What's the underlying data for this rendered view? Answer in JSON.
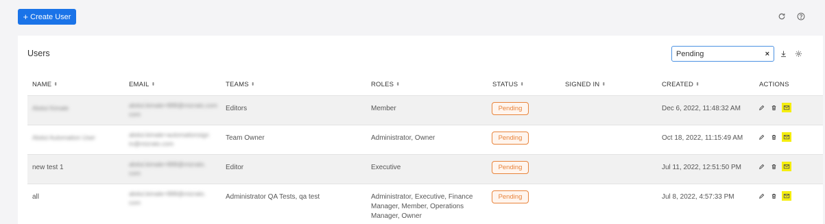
{
  "toolbar": {
    "create_label": "Create User",
    "plus": "+"
  },
  "table": {
    "title": "Users",
    "search": {
      "value": "Pending",
      "clear": "×"
    },
    "columns": [
      "NAME",
      "EMAIL",
      "TEAMS",
      "ROLES",
      "STATUS",
      "SIGNED IN",
      "CREATED",
      "ACTIONS"
    ],
    "sort_glyph": "⬍",
    "rows": [
      {
        "name": "Abdul Kimale",
        "email_1": "abdul.kimale+888@mizrato.com",
        "email_2": "com",
        "teams": "Editors",
        "roles": [
          "Member"
        ],
        "status": "Pending",
        "signed_in": "",
        "created": "Dec 6, 2022, 11:48:32 AM"
      },
      {
        "name": "Abdul Automation User",
        "email_1": "abdul.kimale+automationsign",
        "email_2": "in@mizrato.com",
        "teams": "Team Owner",
        "roles": [
          "Administrator, Owner"
        ],
        "status": "Pending",
        "signed_in": "",
        "created": "Oct 18, 2022, 11:15:49 AM"
      },
      {
        "name": "new test 1",
        "email_1": "abdul.kimale+888@mizrato.",
        "email_2": "com",
        "teams": "Editor",
        "roles": [
          "Executive"
        ],
        "status": "Pending",
        "signed_in": "",
        "created": "Jul 11, 2022, 12:51:50 PM"
      },
      {
        "name": "all",
        "email_1": "abdul.kimale+888@mizrato.",
        "email_2": "com",
        "teams": "Administrator QA Tests, qa test",
        "roles": [
          "Administrator, Executive, Finance",
          "Manager, Member, Operations",
          "Manager, Owner"
        ],
        "status": "Pending",
        "signed_in": "",
        "created": "Jul 8, 2022, 4:57:33 PM"
      }
    ]
  },
  "colors": {
    "primary": "#1a73e8",
    "pending": "#e8833a",
    "mail_highlight": "#f5ee0f"
  },
  "icons": [
    "refresh-icon",
    "help-icon",
    "download-icon",
    "settings-icon",
    "edit-icon",
    "delete-icon",
    "mail-icon"
  ]
}
